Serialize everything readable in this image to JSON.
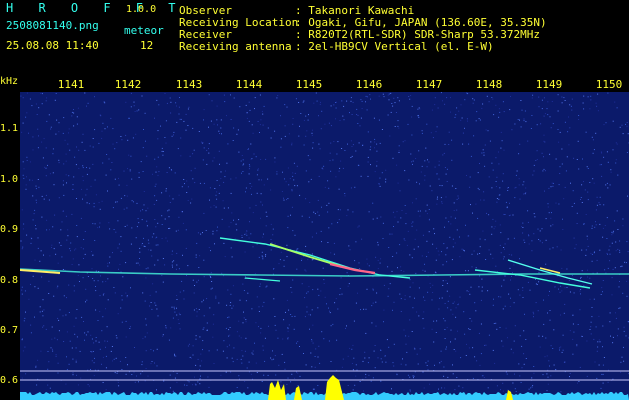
{
  "app": {
    "title": "H R O F F T",
    "version": "1.0.0",
    "filename": "2508081140.png",
    "datetime": "25.08.08 11:40",
    "meteor_label": "meteor",
    "meteor_count": "12"
  },
  "station": {
    "rows": [
      {
        "label": "Observer",
        "value": ": Takanori Kawachi"
      },
      {
        "label": "Receiving Location",
        "value": ": Ogaki, Gifu, JAPAN (136.60E, 35.35N)"
      },
      {
        "label": "Receiver",
        "value": ": R820T2(RTL-SDR) SDR-Sharp 53.372MHz"
      },
      {
        "label": "Receiving antenna",
        "value": ": 2el-HB9CV Vertical (el. E-W)"
      }
    ]
  },
  "axes": {
    "y_unit": "kHz",
    "y_ticks": [
      "1.1",
      "1.0",
      "0.9",
      "0.8",
      "0.7",
      "0.6"
    ],
    "x_ticks": [
      "1141",
      "1142",
      "1143",
      "1144",
      "1145",
      "1146",
      "1147",
      "1148",
      "1149",
      "1150"
    ]
  },
  "colors": {
    "background": "#0b1a6a",
    "label_yellow": "#ffff33",
    "label_cyan": "#33ffee",
    "trace": "#55ffdd",
    "meteor_head": "#ff6688",
    "noise_bar": "#33ccff",
    "burst": "#ffff00"
  }
}
